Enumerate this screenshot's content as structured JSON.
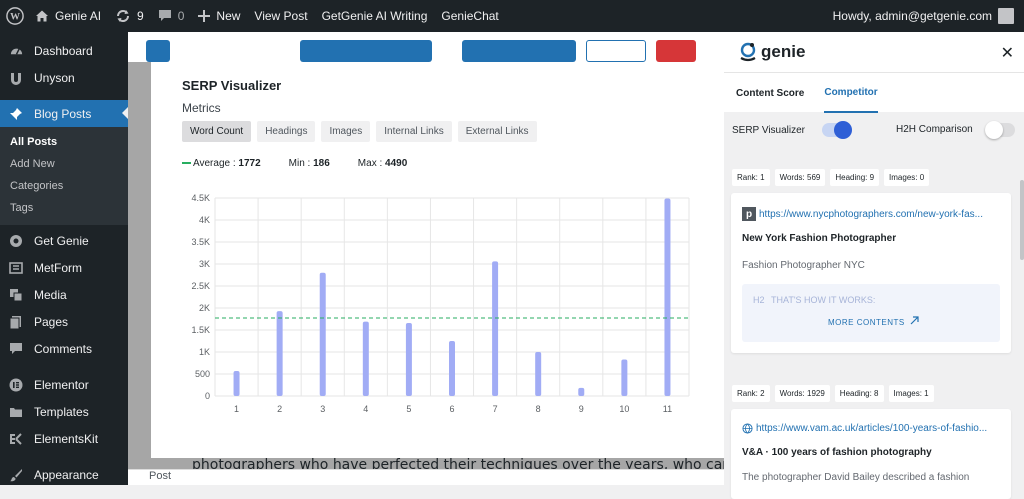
{
  "adminbar": {
    "site_name": "Genie AI",
    "updates_count": "9",
    "comments_count": "0",
    "new_label": "New",
    "view_post": "View Post",
    "getgenie_writing": "GetGenie AI Writing",
    "geniechat": "GenieChat",
    "howdy": "Howdy, admin@getgenie.com"
  },
  "sidebar": {
    "items": [
      {
        "label": "Dashboard",
        "icon": "dashboard-icon"
      },
      {
        "label": "Unyson",
        "icon": "unyson-icon"
      },
      {
        "label": "Blog Posts",
        "icon": "pin-icon"
      },
      {
        "label": "Get Genie",
        "icon": "genie-icon"
      },
      {
        "label": "MetForm",
        "icon": "form-icon"
      },
      {
        "label": "Media",
        "icon": "media-icon"
      },
      {
        "label": "Pages",
        "icon": "pages-icon"
      },
      {
        "label": "Comments",
        "icon": "comment-icon"
      },
      {
        "label": "Elementor",
        "icon": "elementor-icon"
      },
      {
        "label": "Templates",
        "icon": "folder-icon"
      },
      {
        "label": "ElementsKit",
        "icon": "ek-icon"
      },
      {
        "label": "Appearance",
        "icon": "brush-icon"
      }
    ],
    "submenu": [
      "All Posts",
      "Add New",
      "Categories",
      "Tags"
    ]
  },
  "editor": {
    "body_text": "photographers who have perfected their techniques over the years, who can help",
    "footer": "Post"
  },
  "modal": {
    "title": "SERP Visualizer",
    "subtitle": "Metrics",
    "tabs": [
      "Word Count",
      "Headings",
      "Images",
      "Internal Links",
      "External Links"
    ],
    "average_label": "Average :",
    "average_value": "1772",
    "min_label": "Min :",
    "min_value": "186",
    "max_label": "Max :",
    "max_value": "4490"
  },
  "chart_data": {
    "type": "bar",
    "categories": [
      "1",
      "2",
      "3",
      "4",
      "5",
      "6",
      "7",
      "8",
      "9",
      "10",
      "11"
    ],
    "values": [
      569,
      1929,
      2800,
      1690,
      1660,
      1250,
      3060,
      1000,
      186,
      830,
      4490
    ],
    "average": 1772,
    "ylim": [
      0,
      4500
    ],
    "yticks": [
      "0",
      "500",
      "1K",
      "1.5K",
      "2K",
      "2.5K",
      "3K",
      "3.5K",
      "4K",
      "4.5K"
    ],
    "bar_color": "#a1acf5",
    "average_color": "#27ae60",
    "grid": true
  },
  "panel": {
    "logo": "genie",
    "tabs": [
      "Content Score",
      "Competitor"
    ],
    "serp_label": "SERP Visualizer",
    "h2h_label": "H2H Comparison",
    "results": [
      {
        "chips": [
          "Rank: 1",
          "Words: 569",
          "Heading: 9",
          "Images: 0"
        ],
        "url": "https://www.nycphotographers.com/new-york-fas...",
        "title": "New York Fashion Photographer",
        "desc": "Fashion Photographer NYC",
        "heading_tag": "H2",
        "heading_text": "THAT'S HOW IT WORKS:",
        "more": "MORE CONTENTS"
      },
      {
        "chips": [
          "Rank: 2",
          "Words: 1929",
          "Heading: 8",
          "Images: 1"
        ],
        "url": "https://www.vam.ac.uk/articles/100-years-of-fashio...",
        "title": "V&A · 100 years of fashion photography",
        "desc": "The photographer David Bailey described a fashion"
      }
    ]
  }
}
